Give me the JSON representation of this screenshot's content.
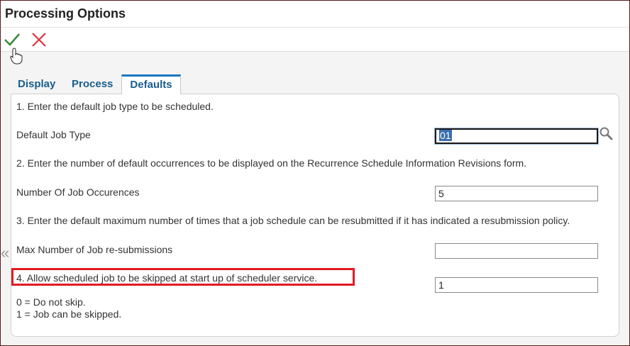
{
  "window": {
    "title": "Processing Options"
  },
  "toolbar": {
    "ok_icon": "checkmark-icon",
    "cancel_icon": "close-x-icon",
    "ok_color": "#3c8a3a",
    "cancel_color": "#d9343a"
  },
  "tabs": [
    {
      "label": "Display",
      "active": false
    },
    {
      "label": "Process",
      "active": false
    },
    {
      "label": "Defaults",
      "active": true
    }
  ],
  "defaults": {
    "q1_text": "1. Enter the default job type to be scheduled.",
    "job_type_label": "Default Job Type",
    "job_type_value": "01",
    "q2_text": "2. Enter the number of default occurrences to be displayed on the Recurrence Schedule Information Revisions form.",
    "occurrences_label": "Number Of Job Occurences",
    "occurrences_value": "5",
    "q3_text": "3. Enter the default maximum number of times that a job schedule can be resubmitted if it has indicated a resubmission policy.",
    "max_resub_label": "Max Number of Job re-submissions",
    "max_resub_value": "",
    "q4_text": "4. Allow scheduled job to be skipped at start up of scheduler service.",
    "skip_value": "1",
    "option_0": "0 = Do not skip.",
    "option_1": "1 = Job can be skipped."
  },
  "colors": {
    "tab_text": "#1a5d8e",
    "active_tab_border": "#1a78c2",
    "highlight": "#e11b22"
  }
}
